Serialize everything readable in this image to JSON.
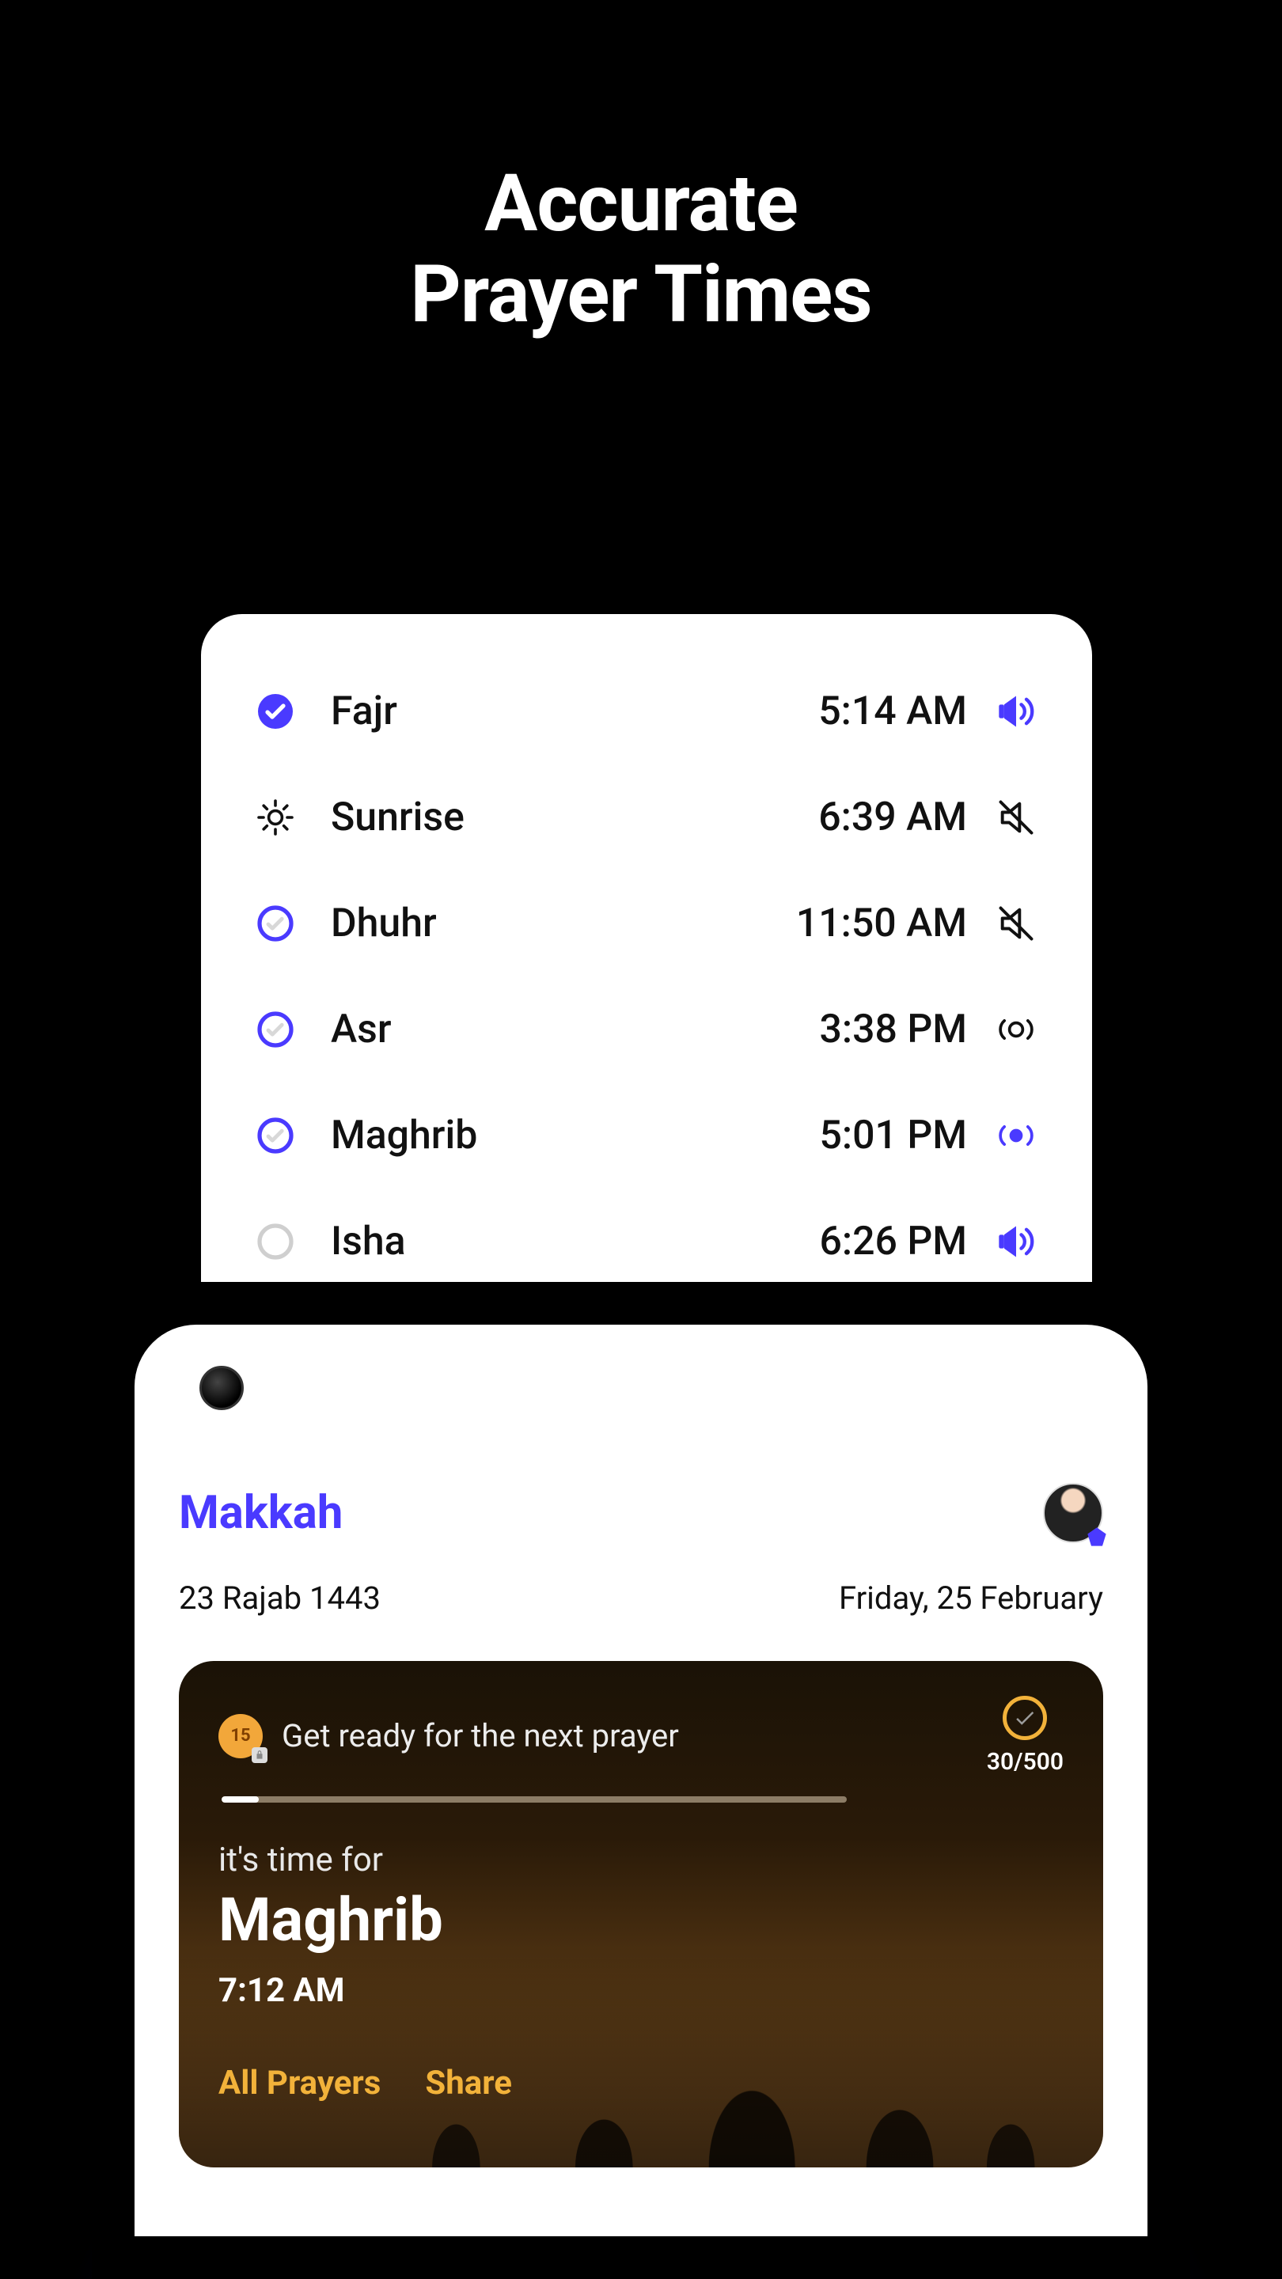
{
  "headline_line1": "Accurate",
  "headline_line2": "Prayer Times",
  "accent": "#4a3aff",
  "prayers": [
    {
      "name": "Fajr",
      "time": "5:14 AM",
      "status_icon": "check-filled",
      "sound_icon": "speaker-on",
      "sound_color": "#4a3aff"
    },
    {
      "name": "Sunrise",
      "time": "6:39 AM",
      "status_icon": "sun",
      "sound_icon": "speaker-muted",
      "sound_color": "#111"
    },
    {
      "name": "Dhuhr",
      "time": "11:50 AM",
      "status_icon": "check-outline",
      "sound_icon": "speaker-muted",
      "sound_color": "#111"
    },
    {
      "name": "Asr",
      "time": "3:38 PM",
      "status_icon": "check-outline",
      "sound_icon": "vibrate-off",
      "sound_color": "#111"
    },
    {
      "name": "Maghrib",
      "time": "5:01 PM",
      "status_icon": "check-outline",
      "sound_icon": "vibrate-on",
      "sound_color": "#4a3aff"
    },
    {
      "name": "Isha",
      "time": "6:26 PM",
      "status_icon": "circle-grey",
      "sound_icon": "speaker-on",
      "sound_color": "#4a3aff"
    }
  ],
  "home": {
    "location": "Makkah",
    "hijri_date": "23 Rajab 1443",
    "greg_date": "Friday, 25 February",
    "streak_badge": "15",
    "ready_msg": "Get ready for the next prayer",
    "progress_label": "30/500",
    "progress_pct": 6,
    "its_time_for": "it's time for",
    "current_prayer": "Maghrib",
    "current_time": "7:12 AM",
    "action_all": "All Prayers",
    "action_share": "Share"
  }
}
